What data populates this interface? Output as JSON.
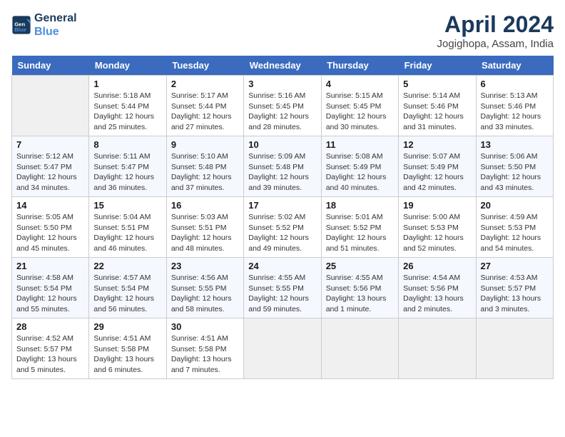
{
  "logo": {
    "line1": "General",
    "line2": "Blue"
  },
  "title": "April 2024",
  "subtitle": "Jogighopa, Assam, India",
  "weekdays": [
    "Sunday",
    "Monday",
    "Tuesday",
    "Wednesday",
    "Thursday",
    "Friday",
    "Saturday"
  ],
  "weeks": [
    [
      {
        "day": "",
        "info": ""
      },
      {
        "day": "1",
        "info": "Sunrise: 5:18 AM\nSunset: 5:44 PM\nDaylight: 12 hours\nand 25 minutes."
      },
      {
        "day": "2",
        "info": "Sunrise: 5:17 AM\nSunset: 5:44 PM\nDaylight: 12 hours\nand 27 minutes."
      },
      {
        "day": "3",
        "info": "Sunrise: 5:16 AM\nSunset: 5:45 PM\nDaylight: 12 hours\nand 28 minutes."
      },
      {
        "day": "4",
        "info": "Sunrise: 5:15 AM\nSunset: 5:45 PM\nDaylight: 12 hours\nand 30 minutes."
      },
      {
        "day": "5",
        "info": "Sunrise: 5:14 AM\nSunset: 5:46 PM\nDaylight: 12 hours\nand 31 minutes."
      },
      {
        "day": "6",
        "info": "Sunrise: 5:13 AM\nSunset: 5:46 PM\nDaylight: 12 hours\nand 33 minutes."
      }
    ],
    [
      {
        "day": "7",
        "info": "Sunrise: 5:12 AM\nSunset: 5:47 PM\nDaylight: 12 hours\nand 34 minutes."
      },
      {
        "day": "8",
        "info": "Sunrise: 5:11 AM\nSunset: 5:47 PM\nDaylight: 12 hours\nand 36 minutes."
      },
      {
        "day": "9",
        "info": "Sunrise: 5:10 AM\nSunset: 5:48 PM\nDaylight: 12 hours\nand 37 minutes."
      },
      {
        "day": "10",
        "info": "Sunrise: 5:09 AM\nSunset: 5:48 PM\nDaylight: 12 hours\nand 39 minutes."
      },
      {
        "day": "11",
        "info": "Sunrise: 5:08 AM\nSunset: 5:49 PM\nDaylight: 12 hours\nand 40 minutes."
      },
      {
        "day": "12",
        "info": "Sunrise: 5:07 AM\nSunset: 5:49 PM\nDaylight: 12 hours\nand 42 minutes."
      },
      {
        "day": "13",
        "info": "Sunrise: 5:06 AM\nSunset: 5:50 PM\nDaylight: 12 hours\nand 43 minutes."
      }
    ],
    [
      {
        "day": "14",
        "info": "Sunrise: 5:05 AM\nSunset: 5:50 PM\nDaylight: 12 hours\nand 45 minutes."
      },
      {
        "day": "15",
        "info": "Sunrise: 5:04 AM\nSunset: 5:51 PM\nDaylight: 12 hours\nand 46 minutes."
      },
      {
        "day": "16",
        "info": "Sunrise: 5:03 AM\nSunset: 5:51 PM\nDaylight: 12 hours\nand 48 minutes."
      },
      {
        "day": "17",
        "info": "Sunrise: 5:02 AM\nSunset: 5:52 PM\nDaylight: 12 hours\nand 49 minutes."
      },
      {
        "day": "18",
        "info": "Sunrise: 5:01 AM\nSunset: 5:52 PM\nDaylight: 12 hours\nand 51 minutes."
      },
      {
        "day": "19",
        "info": "Sunrise: 5:00 AM\nSunset: 5:53 PM\nDaylight: 12 hours\nand 52 minutes."
      },
      {
        "day": "20",
        "info": "Sunrise: 4:59 AM\nSunset: 5:53 PM\nDaylight: 12 hours\nand 54 minutes."
      }
    ],
    [
      {
        "day": "21",
        "info": "Sunrise: 4:58 AM\nSunset: 5:54 PM\nDaylight: 12 hours\nand 55 minutes."
      },
      {
        "day": "22",
        "info": "Sunrise: 4:57 AM\nSunset: 5:54 PM\nDaylight: 12 hours\nand 56 minutes."
      },
      {
        "day": "23",
        "info": "Sunrise: 4:56 AM\nSunset: 5:55 PM\nDaylight: 12 hours\nand 58 minutes."
      },
      {
        "day": "24",
        "info": "Sunrise: 4:55 AM\nSunset: 5:55 PM\nDaylight: 12 hours\nand 59 minutes."
      },
      {
        "day": "25",
        "info": "Sunrise: 4:55 AM\nSunset: 5:56 PM\nDaylight: 13 hours\nand 1 minute."
      },
      {
        "day": "26",
        "info": "Sunrise: 4:54 AM\nSunset: 5:56 PM\nDaylight: 13 hours\nand 2 minutes."
      },
      {
        "day": "27",
        "info": "Sunrise: 4:53 AM\nSunset: 5:57 PM\nDaylight: 13 hours\nand 3 minutes."
      }
    ],
    [
      {
        "day": "28",
        "info": "Sunrise: 4:52 AM\nSunset: 5:57 PM\nDaylight: 13 hours\nand 5 minutes."
      },
      {
        "day": "29",
        "info": "Sunrise: 4:51 AM\nSunset: 5:58 PM\nDaylight: 13 hours\nand 6 minutes."
      },
      {
        "day": "30",
        "info": "Sunrise: 4:51 AM\nSunset: 5:58 PM\nDaylight: 13 hours\nand 7 minutes."
      },
      {
        "day": "",
        "info": ""
      },
      {
        "day": "",
        "info": ""
      },
      {
        "day": "",
        "info": ""
      },
      {
        "day": "",
        "info": ""
      }
    ]
  ]
}
